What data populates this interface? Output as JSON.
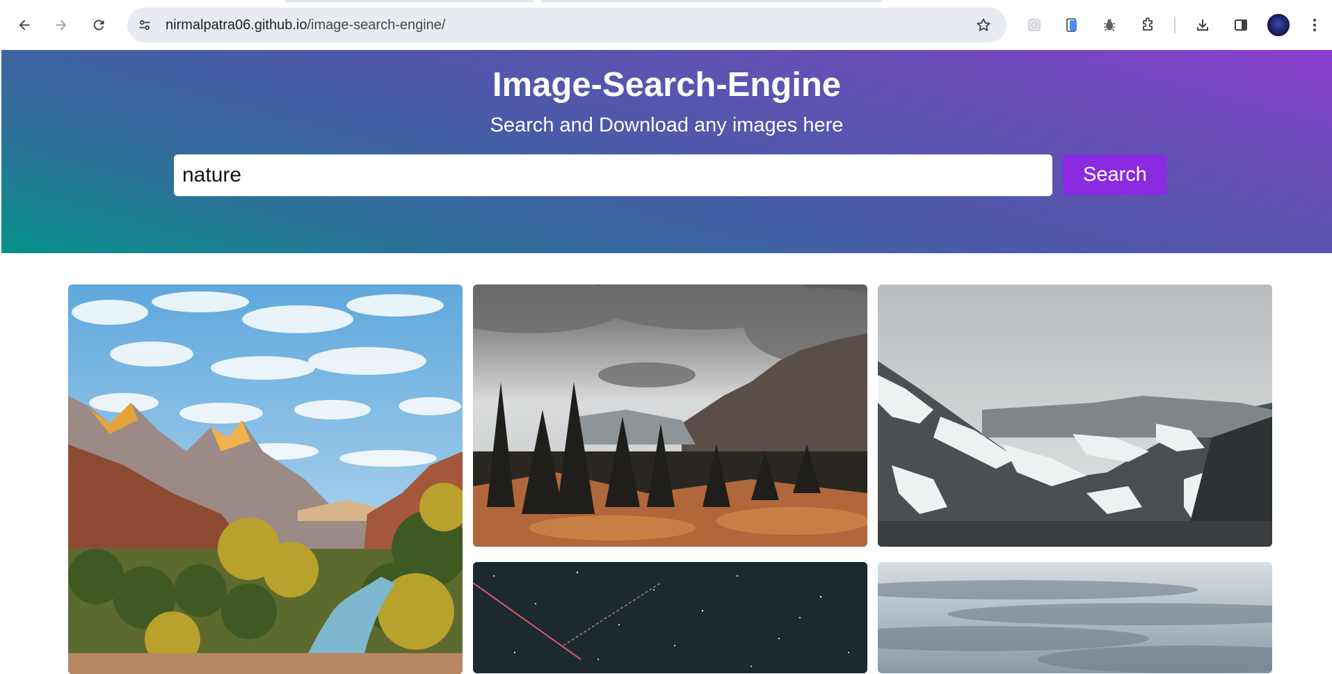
{
  "browser": {
    "url_host": "nirmalpatra06.github.io",
    "url_path": "/image-search-engine/",
    "icons": {
      "back": "arrow-left-icon",
      "forward": "arrow-right-icon",
      "reload": "reload-icon",
      "site_info": "tune-icon",
      "bookmark": "star-icon",
      "extension_1": "puzzle-faded-icon",
      "extension_2": "phone-icon",
      "extension_3": "bug-icon",
      "extensions": "puzzle-icon",
      "downloads": "download-icon",
      "side_panel": "side-panel-icon",
      "profile": "avatar",
      "menu": "kebab-menu-icon"
    }
  },
  "header": {
    "title": "Image-Search-Engine",
    "subtitle": "Search and Download any images here",
    "search_value": "nature",
    "search_button": "Search",
    "colors": {
      "gradient_start": "#06918a",
      "gradient_end": "#8b3dd0",
      "button": "#8a2be2"
    }
  },
  "results": {
    "images": [
      {
        "subject": "canyon-river-mountains"
      },
      {
        "subject": "forest-mountain-clouds"
      },
      {
        "subject": "snowy-mountain-valley"
      },
      {
        "subject": "night-sky-stars"
      },
      {
        "subject": "cloudy-sky"
      }
    ]
  }
}
